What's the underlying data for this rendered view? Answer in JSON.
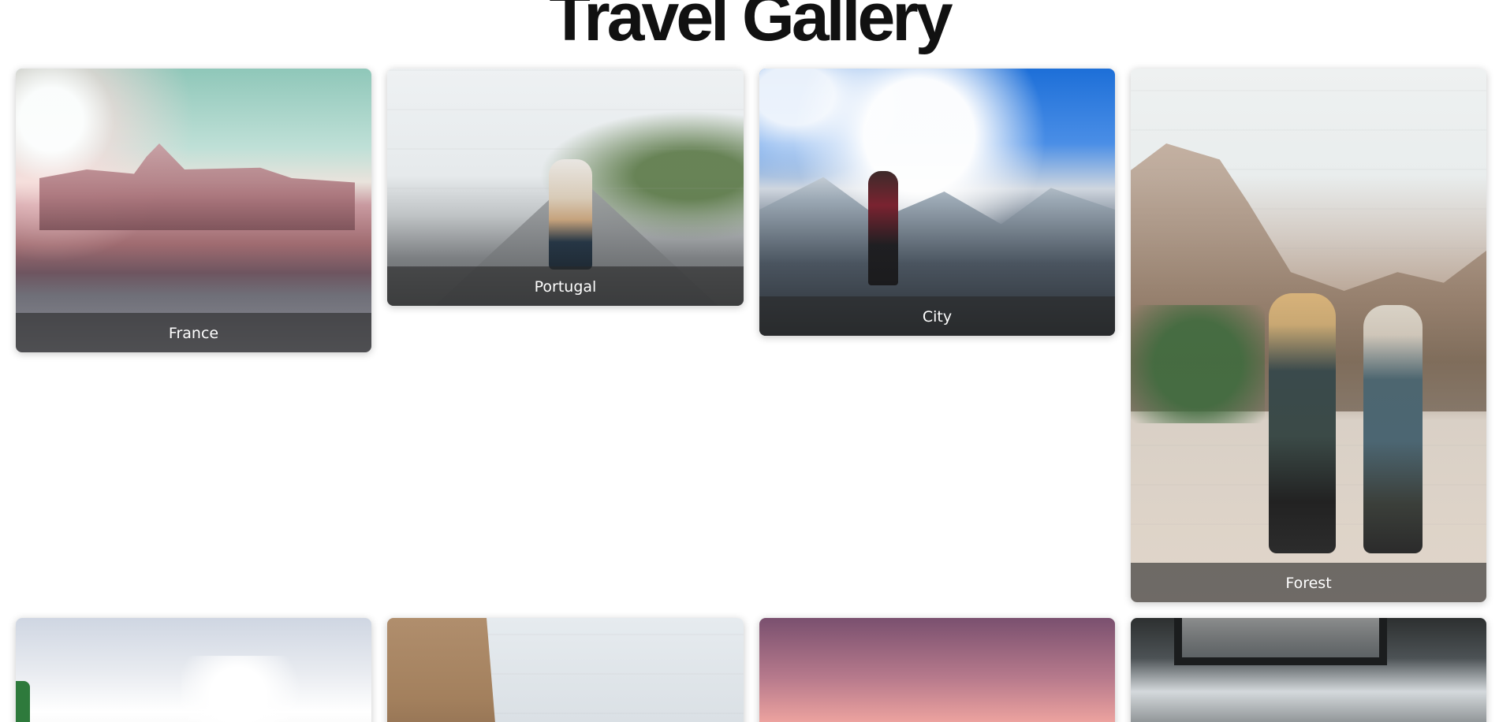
{
  "page": {
    "title": "Travel Gallery"
  },
  "gallery": {
    "cards": [
      {
        "label": "France"
      },
      {
        "label": "Portugal"
      },
      {
        "label": "City"
      },
      {
        "label": "Forest"
      }
    ]
  }
}
